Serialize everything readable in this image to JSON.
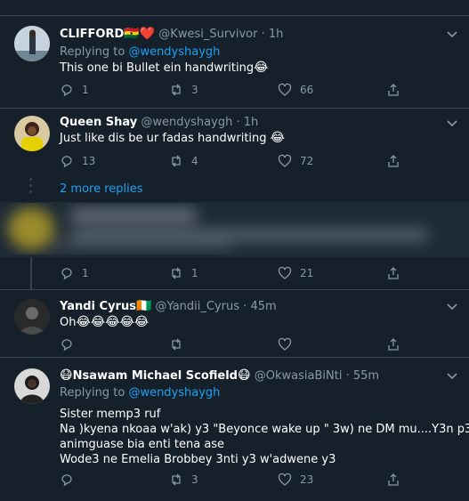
{
  "tweets": [
    {
      "name": "CLIFFORD",
      "name_emoji": "🇬🇭❤️",
      "handle": "@Kwesi_Survivor",
      "time": "1h",
      "replying_label": "Replying to",
      "replying_to": "@wendyshaygh",
      "text": "This one bi Bullet ein handwriting",
      "text_emoji": "😂",
      "replies": "1",
      "retweets": "3",
      "likes": "66"
    },
    {
      "name": "Queen Shay",
      "handle": "@wendyshaygh",
      "time": "1h",
      "text": "Just like dis be ur fadas handwriting",
      "text_emoji": "😂",
      "replies": "13",
      "retweets": "4",
      "likes": "72"
    },
    {
      "blurred": true,
      "replies": "1",
      "retweets": "1",
      "likes": "21"
    },
    {
      "name": "Yandi Cyrus",
      "name_emoji": "🇨🇮",
      "handle": "@Yandii_Cyrus",
      "time": "45m",
      "text": "Oh",
      "text_emoji": "😂😂😂😂😂",
      "replies": "",
      "retweets": "",
      "likes": ""
    },
    {
      "name": "Nsawam Michael Scofield",
      "name_emoji_pre": "😷",
      "name_emoji": "😷",
      "handle": "@OkwasiaBiNti",
      "time": "55m",
      "replying_label": "Replying to",
      "replying_to": "@wendyshaygh",
      "lines": [
        "Sister memp3 ruf",
        "Na )kyena nkoaa w'ak) y3  \"Beyonce wake up \" 3w) ne DM mu....Y3n p3",
        "animguase bia enti tena ase",
        "Wode3 ne Emelia Brobbey 3nti y3 w'adwene y3"
      ],
      "replies": "",
      "retweets": "3",
      "likes": "23"
    }
  ],
  "thread": {
    "more_replies": "2 more replies"
  },
  "colors": {
    "bg": "#15202b",
    "muted": "#8899a6",
    "accent": "#1da1f2",
    "border": "#38444d"
  },
  "icons": [
    "reply-icon",
    "retweet-icon",
    "like-icon",
    "share-icon",
    "chevron-down-icon"
  ]
}
